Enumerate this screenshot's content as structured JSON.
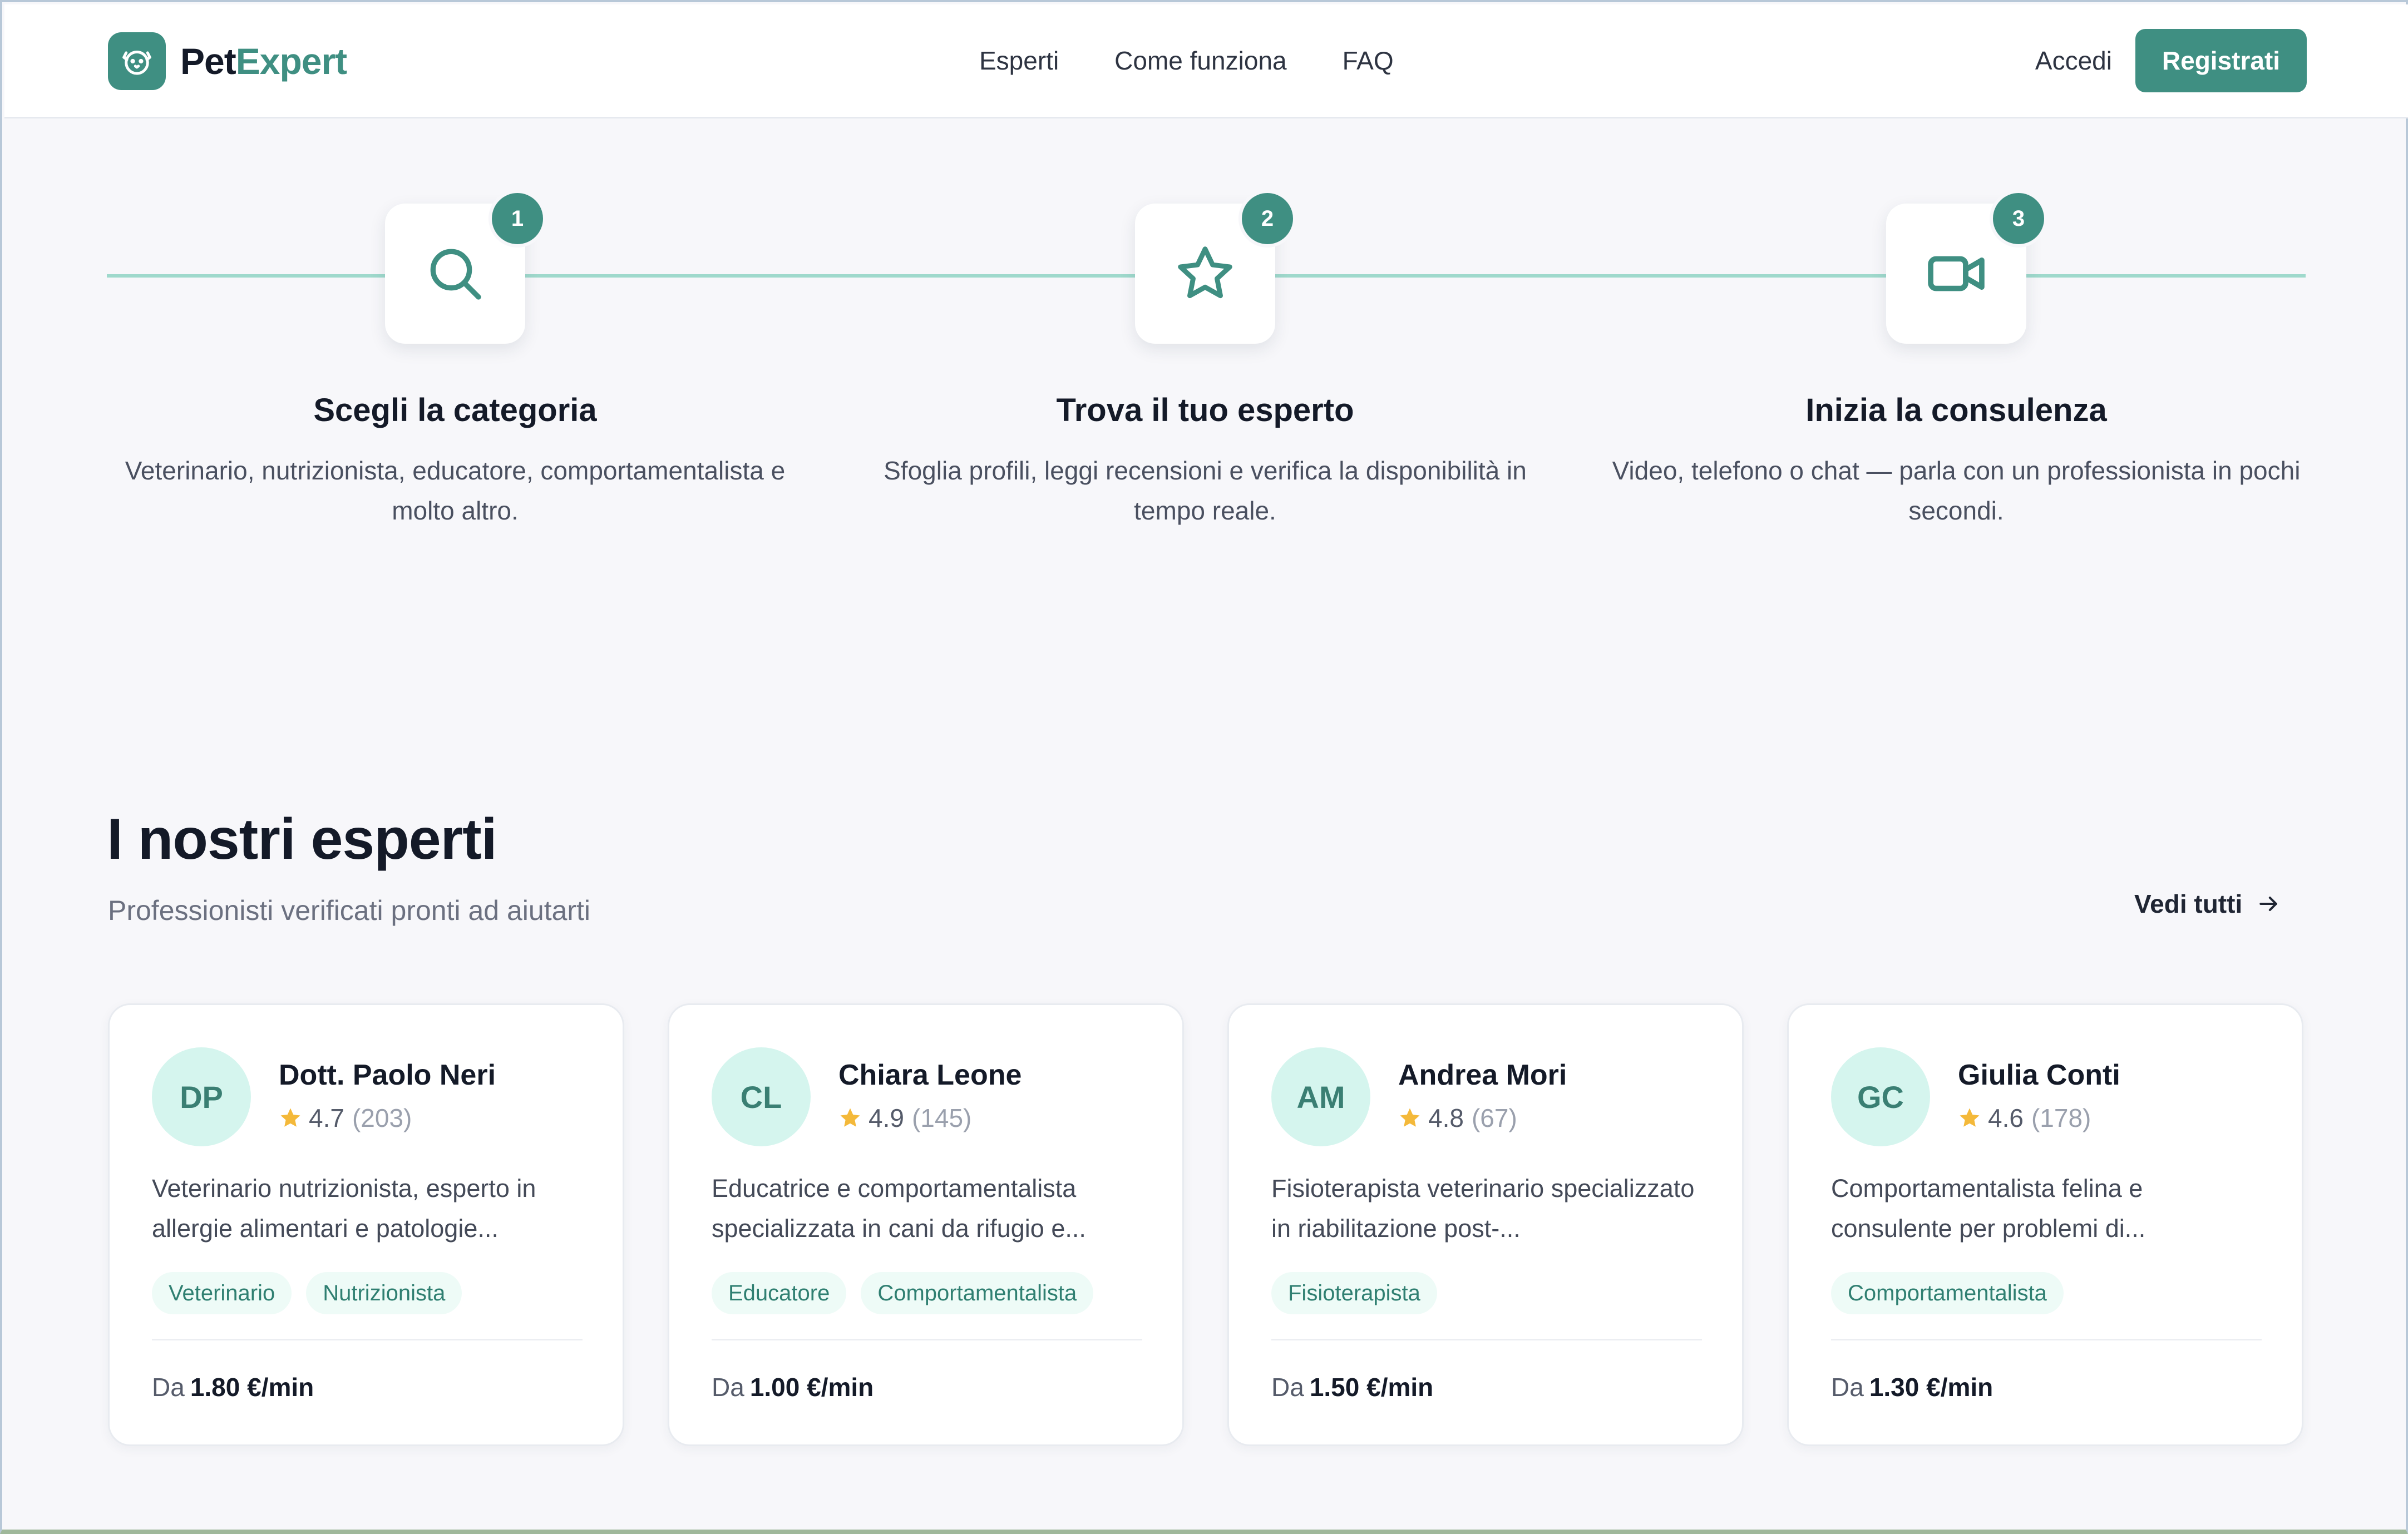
{
  "brand": {
    "name_part1": "Pet",
    "name_part2": "Expert",
    "accent_color": "#3f8f82",
    "logo_icon": "dog-face-icon"
  },
  "nav": {
    "links": [
      "Esperti",
      "Come funziona",
      "FAQ"
    ],
    "login_label": "Accedi",
    "register_label": "Registrati"
  },
  "steps": [
    {
      "number": "1",
      "icon": "search-icon",
      "title": "Scegli la categoria",
      "description": "Veterinario, nutrizionista, educatore, comportamentalista e molto altro."
    },
    {
      "number": "2",
      "icon": "star-icon",
      "title": "Trova il tuo esperto",
      "description": "Sfoglia profili, leggi recensioni e verifica la disponibilità in tempo reale."
    },
    {
      "number": "3",
      "icon": "video-camera-icon",
      "title": "Inizia la consulenza",
      "description": "Video, telefono o chat — parla con un professionista in pochi secondi."
    }
  ],
  "experts_section": {
    "title": "I nostri esperti",
    "subtitle": "Professionisti verificati pronti ad aiutarti",
    "see_all_label": "Vedi tutti"
  },
  "experts": [
    {
      "initials": "DP",
      "name": "Dott. Paolo Neri",
      "rating": "4.7",
      "reviews": "(203)",
      "description": "Veterinario nutrizionista, esperto in allergie alimentari e patologie...",
      "tags": [
        "Veterinario",
        "Nutrizionista"
      ],
      "price_prefix": "Da",
      "price": "1.80 €/min"
    },
    {
      "initials": "CL",
      "name": "Chiara Leone",
      "rating": "4.9",
      "reviews": "(145)",
      "description": "Educatrice e comportamentalista specializzata in cani da rifugio e...",
      "tags": [
        "Educatore",
        "Comportamentalista"
      ],
      "price_prefix": "Da",
      "price": "1.00 €/min"
    },
    {
      "initials": "AM",
      "name": "Andrea Mori",
      "rating": "4.8",
      "reviews": "(67)",
      "description": "Fisioterapista veterinario specializzato in riabilitazione post-...",
      "tags": [
        "Fisioterapista"
      ],
      "price_prefix": "Da",
      "price": "1.50 €/min"
    },
    {
      "initials": "GC",
      "name": "Giulia Conti",
      "rating": "4.6",
      "reviews": "(178)",
      "description": "Comportamentalista felina e consulente per problemi di...",
      "tags": [
        "Comportamentalista"
      ],
      "price_prefix": "Da",
      "price": "1.30 €/min"
    }
  ],
  "colors": {
    "accent": "#3f8f82",
    "avatar_bg": "#d5f5ee",
    "star": "#f4b93a",
    "step_line": "#9fd9cc"
  }
}
